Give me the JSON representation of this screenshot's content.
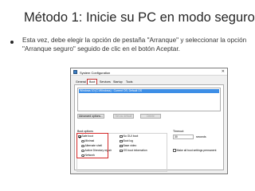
{
  "slide": {
    "title": "Método 1: Inicie su PC en modo seguro",
    "bullet": "Esta vez, debe elegir la opción de pestaña \"Arranque\" y seleccionar la opción \"Arranque seguro\" seguido de clic en el botón Aceptar."
  },
  "dialog": {
    "title": "System Configuration",
    "close": "✕",
    "tabs": [
      "General",
      "Boot",
      "Services",
      "Startup",
      "Tools"
    ],
    "os_entry": "Windows 10 (C:\\Windows) : Current OS; Default OS",
    "buttons": {
      "advanced": "Advanced options...",
      "set_default": "Set as default",
      "delete": "Delete"
    },
    "boot_options_label": "Boot options",
    "safe_boot": {
      "label": "Safe boot",
      "checked": true
    },
    "safe_boot_modes": [
      {
        "label": "Minimal",
        "selected": false
      },
      {
        "label": "Alternate shell",
        "selected": false
      },
      {
        "label": "Active Directory repair",
        "selected": false
      },
      {
        "label": "Network",
        "selected": true
      }
    ],
    "options_right": [
      {
        "label": "No GUI boot",
        "checked": false
      },
      {
        "label": "Boot log",
        "checked": false
      },
      {
        "label": "Base video",
        "checked": false
      },
      {
        "label": "OS boot information",
        "checked": false
      }
    ],
    "timeout_label": "Timeout:",
    "timeout_value": "30",
    "timeout_unit": "seconds",
    "make_permanent": {
      "label": "Make all boot settings permanent",
      "checked": false
    }
  },
  "colors": {
    "highlight": "#d42a2a",
    "selection": "#3d8ee6"
  }
}
